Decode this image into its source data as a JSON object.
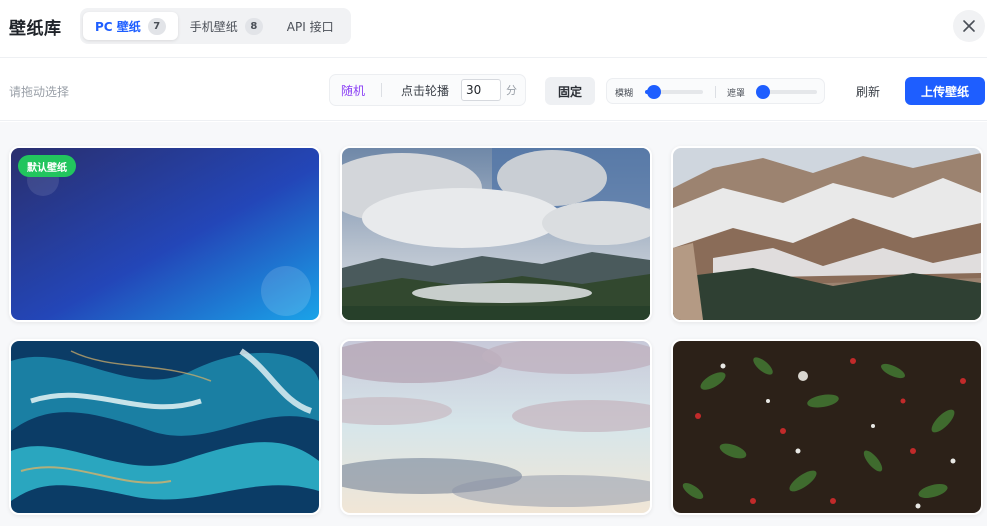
{
  "app": {
    "title": "壁纸库"
  },
  "tabs": [
    {
      "label": "PC 壁纸",
      "count": "7",
      "active": true
    },
    {
      "label": "手机壁纸",
      "count": "8",
      "active": false
    },
    {
      "label": "API 接口",
      "count": "",
      "active": false
    }
  ],
  "toolbar": {
    "hint": "请拖动选择",
    "random_label": "随机",
    "carousel_label": "点击轮播",
    "minutes_value": "30",
    "minutes_unit": "分",
    "fixed_label": "固定",
    "blur_label": "模糊",
    "blur_level": 0.15,
    "mask_label": "遮罩",
    "mask_level": 0.1,
    "refresh_label": "刷新",
    "upload_label": "上传壁纸"
  },
  "colors": {
    "accent": "#1e5eff",
    "random": "#8a3ff5",
    "badge": "#22c55e"
  },
  "wallpapers": [
    {
      "badge": "默认壁纸",
      "subject": "blue-gradient"
    },
    {
      "badge": "",
      "subject": "clouds-over-mountains"
    },
    {
      "badge": "",
      "subject": "snowy-rock-mountains"
    },
    {
      "badge": "",
      "subject": "teal-marble-swirl"
    },
    {
      "badge": "",
      "subject": "pastel-sky-clouds"
    },
    {
      "badge": "",
      "subject": "leaves-and-berries"
    }
  ]
}
